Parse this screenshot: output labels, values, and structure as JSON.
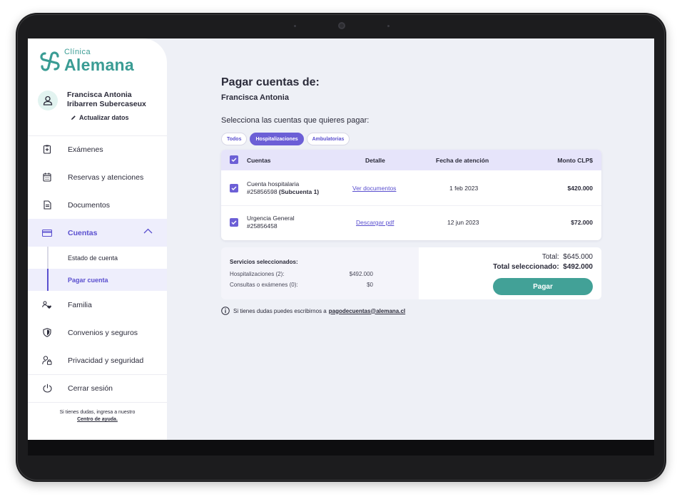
{
  "brand": {
    "small": "Clínica",
    "big": "Alemana",
    "color": "#3a9c94",
    "accent": "#6c5fd6"
  },
  "user": {
    "name_line1": "Francisca Antonia",
    "name_line2": "Iribarren Subercaseux",
    "update_label": "Actualizar datos"
  },
  "nav": {
    "examenes": "Exámenes",
    "reservas": "Reservas y atenciones",
    "documentos": "Documentos",
    "cuentas": "Cuentas",
    "estado_cuenta": "Estado de cuenta",
    "pagar_cuenta": "Pagar cuenta",
    "familia": "Familia",
    "convenios": "Convenios y seguros",
    "privacidad": "Privacidad y seguridad",
    "cerrar_sesion": "Cerrar sesión"
  },
  "help": {
    "text": "Si tienes dudas, ingresa a nuestro",
    "link": "Centro de ayuda."
  },
  "main": {
    "title": "Pagar cuentas de:",
    "subtitle": "Francisca Antonia",
    "select_label": "Selecciona las cuentas que quieres pagar:",
    "filters": [
      "Todos",
      "Hospitalizaciones",
      "Ambulatorias"
    ],
    "active_filter": "Hospitalizaciones"
  },
  "table": {
    "headers": {
      "cuentas": "Cuentas",
      "detalle": "Detalle",
      "fecha": "Fecha de atención",
      "monto": "Monto CLP$"
    },
    "rows": [
      {
        "name": "Cuenta hospitalaria",
        "number": "#25856598",
        "extra": "(Subcuenta 1)",
        "detail": "Ver documentos",
        "date": "1 feb 2023",
        "amount": "$420.000",
        "checked": true
      },
      {
        "name": "Urgencia General",
        "number": "#25856458",
        "extra": "",
        "detail": "Descargar pdf",
        "date": "12 jun 2023",
        "amount": "$72.000",
        "checked": true
      }
    ]
  },
  "summary": {
    "title": "Servicios seleccionados:",
    "hosp_label": "Hospitalizaciones (2):",
    "hosp_value": "$492.000",
    "cons_label": "Consultas o exámenes (0):",
    "cons_value": "$0",
    "total_label": "Total:",
    "total_value": "$645.000",
    "selected_label": "Total seleccionado:",
    "selected_value": "$492.000",
    "pay_label": "Pagar"
  },
  "info": {
    "text": "Si tienes dudas puedes escribirnos a",
    "email": "pagodecuentas@alemana.cl"
  }
}
